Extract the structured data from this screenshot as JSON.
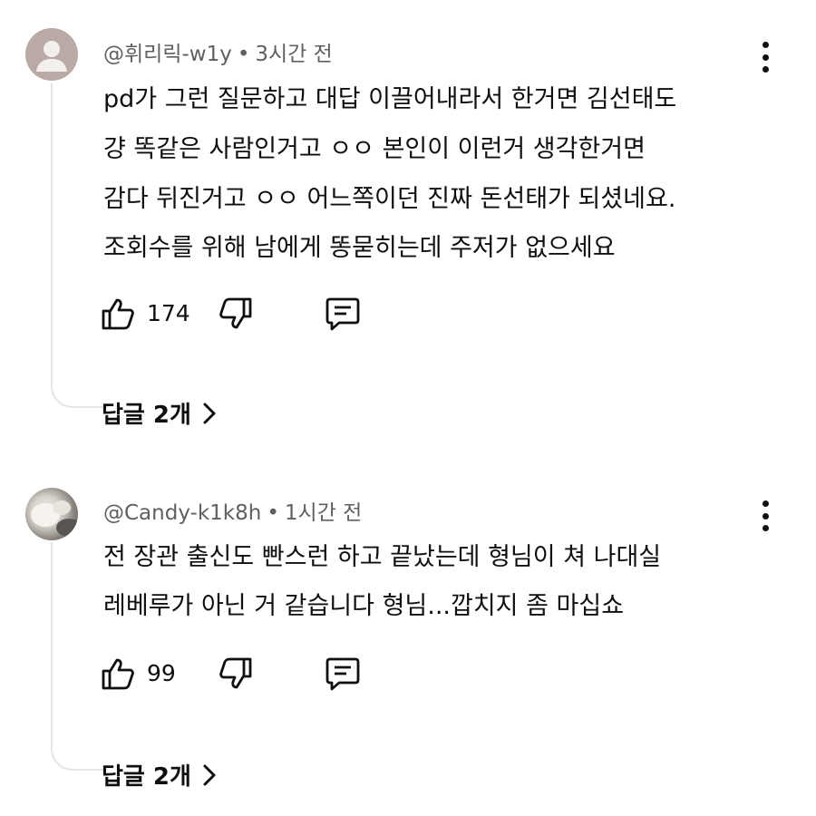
{
  "comments": [
    {
      "username": "@휘리릭-w1y",
      "time": "3시간 전",
      "lines": [
        "pd가 그런 질문하고 대답 이끌어내라서 한거면 김선태도",
        "걍  똑같은 사람인거고 ㅇㅇ 본인이 이런거 생각한거면",
        "감다 뒤진거고 ㅇㅇ 어느쪽이던 진짜 돈선태가 되셨네요.",
        "조회수를 위해 남에게 똥묻히는데 주저가 없으세요"
      ],
      "likes": "174",
      "replies_label": "답글 2개",
      "avatar": "default-avatar"
    },
    {
      "username": "@Candy-k1k8h",
      "time": "1시간 전",
      "lines": [
        "전 장관 출신도 빤스런 하고 끝났는데 형님이 쳐 나대실",
        "레베루가 아닌 거 같습니다 형님...깝치지 좀 마십쇼"
      ],
      "likes": "99",
      "replies_label": "답글 2개",
      "avatar": "photo-avatar"
    }
  ],
  "separator": "•",
  "icons": {
    "like": "thumbs-up-icon",
    "dislike": "thumbs-down-icon",
    "reply": "comment-icon",
    "more": "more-vertical-icon",
    "chevron": "chevron-right-icon"
  }
}
